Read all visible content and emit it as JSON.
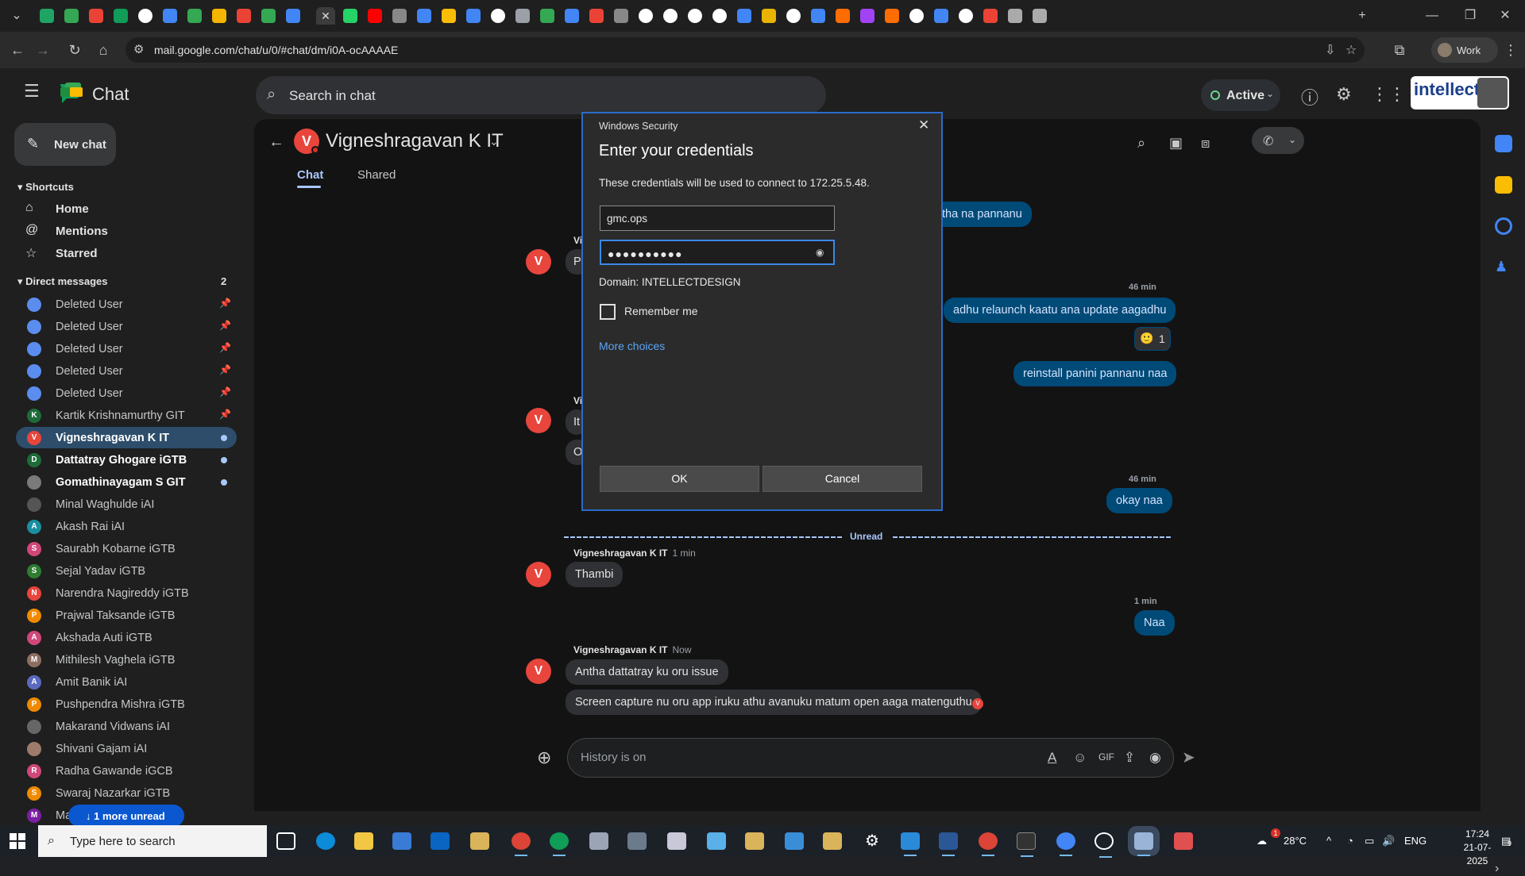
{
  "browser": {
    "url": "mail.google.com/chat/u/0/#chat/dm/i0A-ocAAAAE",
    "profile_label": "Work",
    "tab_favicon_colors": [
      "#1fa463",
      "#34a853",
      "#ea4335",
      "#0f9d58",
      "#ffffff",
      "#4285f4",
      "#34a853",
      "#f4b400",
      "#ea4335",
      "#34a853",
      "#4285f4",
      "#25d366",
      "#ff0000",
      "#888888",
      "#4285f4",
      "#fbbc04",
      "#4285f4",
      "#ffffff",
      "#9aa0a6",
      "#34a853",
      "#4285f4",
      "#ea4335",
      "#888888",
      "#ffffff",
      "#ffffff",
      "#ffffff",
      "#ffffff",
      "#4285f4",
      "#e8b400",
      "#ffffff",
      "#4285f4",
      "#ff6d00",
      "#a142f4",
      "#ff6d00",
      "#ffffff",
      "#4285f4",
      "#ffffff",
      "#ea4335",
      "#aaaaaa",
      "#aaaaaa"
    ]
  },
  "app": {
    "title": "Chat",
    "search_placeholder": "Search in chat",
    "status_label": "Active",
    "org_badge": "intellect"
  },
  "sidebar": {
    "new_chat_label": "New chat",
    "shortcuts_heading": "Shortcuts",
    "shortcuts": [
      {
        "label": "Home",
        "icon": "home-icon"
      },
      {
        "label": "Mentions",
        "icon": "at-icon"
      },
      {
        "label": "Starred",
        "icon": "star-icon"
      }
    ],
    "dm_heading": "Direct messages",
    "dm_count": "2",
    "dms": [
      {
        "label": "Deleted User",
        "initial": "",
        "color": "#5b8def",
        "pinned": true
      },
      {
        "label": "Deleted User",
        "initial": "",
        "color": "#5b8def",
        "pinned": true
      },
      {
        "label": "Deleted User",
        "initial": "",
        "color": "#5b8def",
        "pinned": true
      },
      {
        "label": "Deleted User",
        "initial": "",
        "color": "#5b8def",
        "pinned": true
      },
      {
        "label": "Deleted User",
        "initial": "",
        "color": "#5b8def",
        "pinned": true
      },
      {
        "label": "Kartik Krishnamurthy GIT",
        "initial": "K",
        "color": "#1e6b3a",
        "pinned": true
      },
      {
        "label": "Vigneshragavan K IT",
        "initial": "V",
        "color": "#e8453c",
        "selected": true,
        "unread": true
      },
      {
        "label": "Dattatray Ghogare iGTB",
        "initial": "D",
        "color": "#1e6b3a",
        "unread": true
      },
      {
        "label": "Gomathinayagam S GIT",
        "initial": "",
        "color": "#7a7a7a",
        "unread": true
      },
      {
        "label": "Minal Waghulde iAI",
        "initial": "",
        "color": "#555555"
      },
      {
        "label": "Akash Rai iAI",
        "initial": "A",
        "color": "#1a8fa0"
      },
      {
        "label": "Saurabh Kobarne iGTB",
        "initial": "S",
        "color": "#d0477a"
      },
      {
        "label": "Sejal Yadav iGTB",
        "initial": "S",
        "color": "#2e7d32"
      },
      {
        "label": "Narendra Nagireddy iGTB",
        "initial": "N",
        "color": "#e8453c"
      },
      {
        "label": "Prajwal Taksande iGTB",
        "initial": "P",
        "color": "#ef8a00"
      },
      {
        "label": "Akshada Auti iGTB",
        "initial": "A",
        "color": "#d0477a"
      },
      {
        "label": "Mithilesh Vaghela iGTB",
        "initial": "M",
        "color": "#8d6e63"
      },
      {
        "label": "Amit Banik iAI",
        "initial": "A",
        "color": "#5b6abf"
      },
      {
        "label": "Pushpendra Mishra iGTB",
        "initial": "P",
        "color": "#ef8a00"
      },
      {
        "label": "Makarand Vidwans iAI",
        "initial": "",
        "color": "#666666"
      },
      {
        "label": "Shivani Gajam iAI",
        "initial": "",
        "color": "#9e7a6a"
      },
      {
        "label": "Radha Gawande iGCB",
        "initial": "R",
        "color": "#d0477a"
      },
      {
        "label": "Swaraj Nazarkar iGTB",
        "initial": "S",
        "color": "#ef8a00"
      },
      {
        "label": "Ma",
        "initial": "M",
        "color": "#7b1fa2"
      }
    ],
    "more_unread": "1 more unread"
  },
  "conversation": {
    "name": "Vigneshragavan K IT",
    "avatar_initial": "V",
    "tabs": [
      "Chat",
      "Shared"
    ],
    "messages": [
      {
        "dir": "out",
        "text": "reinstall tha na pannanu"
      },
      {
        "dir": "in_partial",
        "text": "P",
        "sender_partial": "Vi"
      },
      {
        "dir": "ts",
        "text": "46 min"
      },
      {
        "dir": "out",
        "text": "adhu relaunch kaatu ana update aagadhu"
      },
      {
        "dir": "reaction",
        "emoji": "🙂",
        "count": "1"
      },
      {
        "dir": "out",
        "text": "reinstall panini pannanu naa"
      },
      {
        "dir": "in_partial",
        "text": "It",
        "sender_partial": "Vi"
      },
      {
        "dir": "in_partial",
        "text": "O"
      },
      {
        "dir": "ts",
        "text": "46 min"
      },
      {
        "dir": "out",
        "text": "okay naa"
      },
      {
        "dir": "divider",
        "text": "Unread"
      },
      {
        "dir": "in",
        "sender": "Vigneshragavan K IT",
        "time": "1 min",
        "text": "Thambi"
      },
      {
        "dir": "ts",
        "text": "1 min"
      },
      {
        "dir": "out",
        "text": "Naa"
      },
      {
        "dir": "in",
        "sender": "Vigneshragavan K IT",
        "time": "Now",
        "text": "Antha dattatray ku oru issue"
      },
      {
        "dir": "in",
        "text": "Screen capture nu oru app iruku athu avanuku matum open aaga matenguthu"
      }
    ],
    "composer_placeholder": "History is on"
  },
  "dialog": {
    "window_title": "Windows Security",
    "heading": "Enter your credentials",
    "description": "These credentials will be used to connect to 172.25.5.48.",
    "username": "gmc.ops",
    "password_mask": "●●●●●●●●●●",
    "domain": "Domain: INTELLECTDESIGN",
    "remember_label": "Remember me",
    "more_choices": "More choices",
    "ok_label": "OK",
    "cancel_label": "Cancel"
  },
  "taskbar": {
    "search_placeholder": "Type here to search",
    "weather": "28°C",
    "language": "ENG",
    "time": "17:24",
    "date": "21-07-2025",
    "notification_count": "9",
    "weather_badge": "1"
  }
}
